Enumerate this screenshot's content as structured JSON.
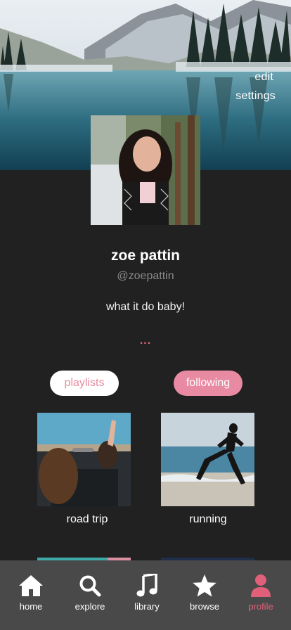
{
  "header": {
    "edit_label": "edit",
    "settings_label": "settings"
  },
  "profile": {
    "name": "zoe pattin",
    "handle": "@zoepattin",
    "bio": "what it do baby!",
    "more": "..."
  },
  "toggles": {
    "playlists_label": "playlists",
    "following_label": "following"
  },
  "playlists": [
    {
      "title": "road trip"
    },
    {
      "title": "running"
    }
  ],
  "tabbar": {
    "items": [
      {
        "label": "home",
        "icon": "home-icon"
      },
      {
        "label": "explore",
        "icon": "search-icon"
      },
      {
        "label": "library",
        "icon": "music-note-icon"
      },
      {
        "label": "browse",
        "icon": "star-icon"
      },
      {
        "label": "profile",
        "icon": "person-icon"
      }
    ],
    "active": "profile"
  },
  "colors": {
    "accent": "#e0607a",
    "pill_pink": "#e88aa2",
    "background": "#212121",
    "tabbar": "#494949"
  }
}
